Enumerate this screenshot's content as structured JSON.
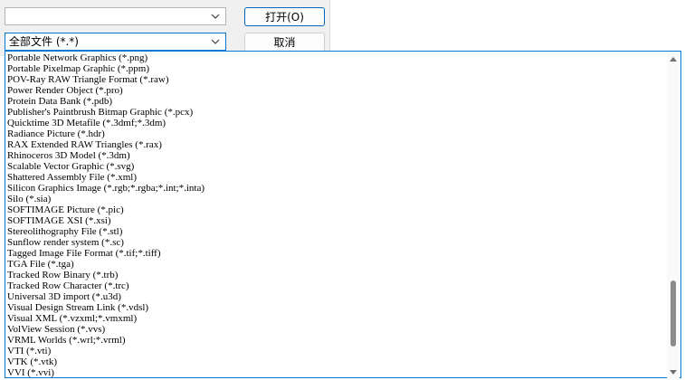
{
  "file_name": {
    "value": ""
  },
  "file_type": {
    "selected": "全部文件 (*.*)"
  },
  "buttons": {
    "open_label": "打开(O)",
    "cancel_label": "取消"
  },
  "file_type_options": [
    "Portable Network Graphics (*.png)",
    "Portable Pixelmap Graphic (*.ppm)",
    "POV-Ray RAW Triangle Format (*.raw)",
    "Power Render Object (*.pro)",
    "Protein Data Bank (*.pdb)",
    "Publisher's Paintbrush Bitmap Graphic (*.pcx)",
    "Quicktime 3D Metafile (*.3dmf;*.3dm)",
    "Radiance Picture (*.hdr)",
    "RAX Extended RAW Triangles (*.rax)",
    "Rhinoceros 3D Model (*.3dm)",
    "Scalable Vector Graphic (*.svg)",
    "Shattered Assembly File (*.xml)",
    "Silicon Graphics Image (*.rgb;*.rgba;*.int;*.inta)",
    "Silo (*.sia)",
    "SOFTIMAGE Picture (*.pic)",
    "SOFTIMAGE XSI (*.xsi)",
    "Stereolithography File (*.stl)",
    "Sunflow render system (*.sc)",
    "Tagged Image File Format (*.tif;*.tiff)",
    "TGA File (*.tga)",
    "Tracked Row Binary (*.trb)",
    "Tracked Row Character (*.trc)",
    "Universal 3D import (*.u3d)",
    "Visual Design Stream Link (*.vdsl)",
    "Visual XML (*.vzxml;*.vmxml)",
    "VolView Session (*.vvs)",
    "VRML Worlds (*.wrl;*.vrml)",
    "VTI (*.vti)",
    "VTK (*.vtk)",
    "VVI (*.vvi)"
  ],
  "scrollbar": {
    "position_fraction": 0.92,
    "visible_fraction": 0.22
  },
  "icons": {
    "combo_arrow": "chevron-down-icon",
    "scroll_up": "scroll-up-arrow-icon",
    "scroll_down": "scroll-down-arrow-icon"
  },
  "colors": {
    "accent": "#0078d4",
    "thumb": "#8a8a8a",
    "dialog_bg": "#f0f0f0"
  }
}
